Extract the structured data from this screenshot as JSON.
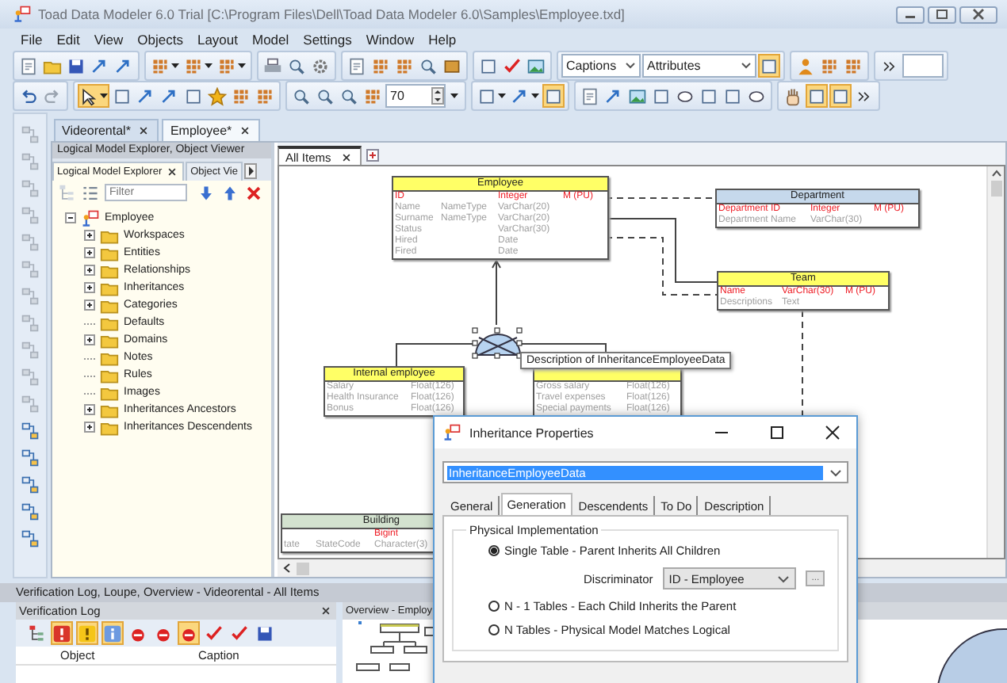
{
  "window": {
    "title": "Toad Data Modeler 6.0 Trial [C:\\Program Files\\Dell\\Toad Data Modeler 6.0\\Samples\\Employee.txd]"
  },
  "menu": [
    "File",
    "Edit",
    "View",
    "Objects",
    "Layout",
    "Model",
    "Settings",
    "Window",
    "Help"
  ],
  "toolbars": [
    [
      [
        {
          "kind": "button",
          "pressed": false
        },
        {
          "kind": "button",
          "pressed": false
        },
        {
          "kind": "button",
          "pressed": false
        },
        {
          "kind": "button",
          "pressed": false
        },
        {
          "kind": "button",
          "pressed": false
        }
      ],
      [
        {
          "kind": "split",
          "pressed": false
        },
        {
          "kind": "split",
          "pressed": false
        },
        {
          "kind": "split",
          "pressed": false
        }
      ],
      [
        {
          "kind": "button",
          "pressed": false
        },
        {
          "kind": "button",
          "pressed": false
        },
        {
          "kind": "button",
          "pressed": false
        }
      ],
      [
        {
          "kind": "button",
          "pressed": false
        },
        {
          "kind": "button",
          "pressed": false
        },
        {
          "kind": "button",
          "pressed": false
        },
        {
          "kind": "button",
          "pressed": false
        },
        {
          "kind": "button",
          "pressed": false
        }
      ],
      [
        {
          "kind": "button",
          "pressed": false
        },
        {
          "kind": "button",
          "pressed": false
        },
        {
          "kind": "button",
          "pressed": false
        }
      ],
      [
        {
          "kind": "select",
          "value": "Captions"
        },
        {
          "kind": "select",
          "value": "Attributes"
        },
        {
          "kind": "button",
          "pressed": true
        }
      ],
      [
        {
          "kind": "button",
          "pressed": false
        },
        {
          "kind": "button",
          "pressed": false
        },
        {
          "kind": "button",
          "pressed": false
        }
      ],
      [
        {
          "kind": "button",
          "pressed": false
        },
        {
          "kind": "field"
        }
      ]
    ],
    [
      [
        {
          "kind": "button",
          "pressed": false
        },
        {
          "kind": "button",
          "pressed": false
        }
      ],
      [
        {
          "kind": "split",
          "pressed": true
        },
        {
          "kind": "button",
          "pressed": false
        },
        {
          "kind": "button",
          "pressed": false
        },
        {
          "kind": "button",
          "pressed": false
        },
        {
          "kind": "button",
          "pressed": false
        },
        {
          "kind": "button",
          "pressed": false
        },
        {
          "kind": "button",
          "pressed": false
        },
        {
          "kind": "button",
          "pressed": false
        }
      ],
      [
        {
          "kind": "button",
          "pressed": false
        },
        {
          "kind": "button",
          "pressed": false
        },
        {
          "kind": "button",
          "pressed": false
        },
        {
          "kind": "button",
          "pressed": false
        },
        {
          "kind": "spin",
          "value": "70"
        }
      ],
      [
        {
          "kind": "split",
          "pressed": false
        },
        {
          "kind": "split",
          "pressed": false
        },
        {
          "kind": "button",
          "pressed": true
        }
      ],
      [
        {
          "kind": "button",
          "pressed": false
        },
        {
          "kind": "button",
          "pressed": false
        },
        {
          "kind": "button",
          "pressed": false
        },
        {
          "kind": "button",
          "pressed": false
        },
        {
          "kind": "button",
          "pressed": false
        },
        {
          "kind": "button",
          "pressed": false
        },
        {
          "kind": "button",
          "pressed": false
        },
        {
          "kind": "button",
          "pressed": false
        }
      ],
      [
        {
          "kind": "button",
          "pressed": false
        },
        {
          "kind": "button",
          "pressed": true
        },
        {
          "kind": "button",
          "pressed": true
        },
        {
          "kind": "button",
          "pressed": false
        }
      ]
    ]
  ],
  "left_toolbar": [
    {
      "disabled": true
    },
    {
      "disabled": true
    },
    {
      "disabled": true
    },
    {
      "disabled": true
    },
    {
      "disabled": true
    },
    {
      "disabled": true
    },
    {
      "disabled": true
    },
    {
      "disabled": true
    },
    {
      "disabled": true
    },
    {
      "disabled": true
    },
    {
      "disabled": true
    },
    {
      "disabled": false
    },
    {
      "disabled": false
    },
    {
      "disabled": false
    },
    {
      "disabled": false
    },
    {
      "disabled": false
    }
  ],
  "document_tabs": [
    {
      "label": "Videorental*",
      "selected": false
    },
    {
      "label": "Employee*",
      "selected": true
    }
  ],
  "explorer": {
    "panel_title": "Logical Model Explorer, Object Viewer",
    "tabs": [
      {
        "label": "Logical Model Explorer",
        "selected": true
      },
      {
        "label": "Object Vie",
        "selected": false
      }
    ],
    "filter": {
      "placeholder": "Filter"
    },
    "tree": {
      "label": "Employee",
      "expanded": true,
      "children": [
        {
          "label": "Workspaces",
          "expandable": true
        },
        {
          "label": "Entities",
          "expandable": true
        },
        {
          "label": "Relationships",
          "expandable": true
        },
        {
          "label": "Inheritances",
          "expandable": true
        },
        {
          "label": "Categories",
          "expandable": true
        },
        {
          "label": "Defaults",
          "expandable": false
        },
        {
          "label": "Domains",
          "expandable": true
        },
        {
          "label": "Notes",
          "expandable": false
        },
        {
          "label": "Rules",
          "expandable": false
        },
        {
          "label": "Images",
          "expandable": false
        },
        {
          "label": "Inheritances Ancestors",
          "expandable": true
        },
        {
          "label": "Inheritances Descendents",
          "expandable": true
        }
      ]
    }
  },
  "diagram": {
    "tabs": [
      {
        "label": "All Items",
        "selected": true
      }
    ],
    "entities": [
      {
        "name": "Employee",
        "color": "#ffff66",
        "attributes": [
          {
            "name": "ID",
            "type": "Integer",
            "key": "M  (PU)",
            "primary": true
          },
          {
            "name": "Name",
            "domain": "NameType",
            "type": "VarChar(20)",
            "primary": false
          },
          {
            "name": "Surname",
            "domain": "NameType",
            "type": "VarChar(20)",
            "primary": false
          },
          {
            "name": "Status",
            "type": "VarChar(30)",
            "primary": false
          },
          {
            "name": "Hired",
            "type": "Date",
            "primary": false
          },
          {
            "name": "Fired",
            "type": "Date",
            "primary": false
          }
        ]
      },
      {
        "name": "Department",
        "color": "#c6d9ec",
        "attributes": [
          {
            "name": "Department ID",
            "type": "Integer",
            "key": "M  (PU)",
            "primary": true
          },
          {
            "name": "Department Name",
            "type": "VarChar(30)",
            "primary": false
          }
        ]
      },
      {
        "name": "Team",
        "color": "#ffff66",
        "attributes": [
          {
            "name": "Name",
            "type": "VarChar(30)",
            "key": "M  (PU)",
            "primary": true
          },
          {
            "name": "Descriptions",
            "type": "Text",
            "primary": false
          }
        ]
      },
      {
        "name": "Internal employee",
        "color": "#ffff66",
        "attributes": [
          {
            "name": "Salary",
            "type": "Float(126)",
            "primary": false
          },
          {
            "name": "Health Insurance",
            "type": "Float(126)",
            "primary": false
          },
          {
            "name": "Bonus",
            "type": "Float(126)",
            "primary": false
          }
        ]
      },
      {
        "color": "#ffff66",
        "attributes": [
          {
            "name": "Gross salary",
            "type": "Float(126)",
            "primary": false
          },
          {
            "name": "Travel expenses",
            "type": "Float(126)",
            "primary": false
          },
          {
            "name": "Special payments",
            "type": "Float(126)",
            "primary": false
          }
        ]
      },
      {
        "name": "Building",
        "color": "#d3e2cf",
        "attributes": [
          {
            "type": "Bigint",
            "primary": true
          },
          {
            "name": "tate",
            "domain": "StateCode",
            "type": "Character(3)",
            "primary": false
          }
        ]
      }
    ],
    "tooltip": "Description of InheritanceEmployeeData"
  },
  "dialog": {
    "title": "Inheritance Properties",
    "object": "InheritanceEmployeeData",
    "tabs": [
      {
        "label": "General",
        "selected": false
      },
      {
        "label": "Generation",
        "selected": true
      },
      {
        "label": "Descendents",
        "selected": false
      },
      {
        "label": "To Do",
        "selected": false
      },
      {
        "label": "Description",
        "selected": false
      }
    ],
    "group_title": "Physical Implementation",
    "options": [
      {
        "label": "Single Table - Parent Inherits All Children",
        "selected": true
      },
      {
        "label": "N - 1 Tables - Each Child Inherits the Parent",
        "selected": false
      },
      {
        "label": "N Tables - Physical Model Matches Logical",
        "selected": false
      }
    ],
    "discriminator": {
      "label": "Discriminator",
      "value": "ID - Employee",
      "button": "..."
    }
  },
  "bottom_panel": {
    "title": "Verification Log, Loupe, Overview - Videorental - All Items",
    "verification_log": {
      "title": "Verification Log",
      "toolbar": [
        {
          "pressed": false
        },
        {
          "pressed": true
        },
        {
          "pressed": true
        },
        {
          "pressed": true
        },
        {
          "pressed": false
        },
        {
          "pressed": false
        },
        {
          "pressed": true
        },
        {
          "pressed": false
        },
        {
          "pressed": false
        },
        {
          "pressed": false
        }
      ],
      "columns": [
        "Object",
        "Caption"
      ]
    },
    "overview": {
      "title": "Overview - Employ"
    }
  }
}
